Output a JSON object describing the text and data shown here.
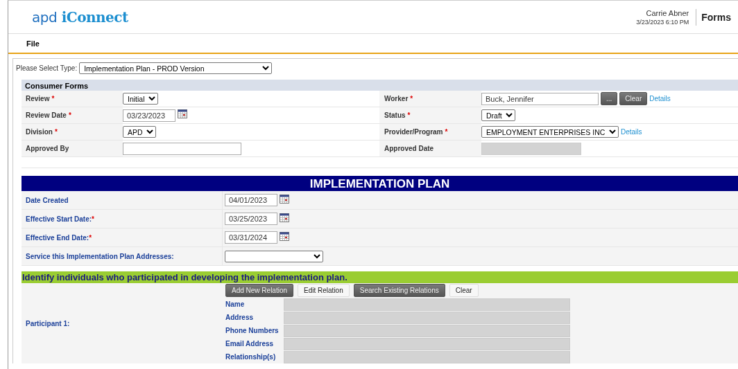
{
  "header": {
    "logo_mark": "apd",
    "logo_text": "iConnect",
    "user": "Carrie Abner",
    "datetime": "3/23/2023 6:10 PM",
    "module": "Forms"
  },
  "menu": [
    {
      "label": "File"
    }
  ],
  "type_select": {
    "label": "Please Select Type:",
    "value": "Implementation Plan - PROD Version"
  },
  "consumer_forms": {
    "title": "Consumer Forms",
    "rows": [
      [
        {
          "label": "Review",
          "required_mark": "*",
          "kind": "select",
          "value": "Initial"
        },
        {
          "label": "Worker",
          "required_mark": "*",
          "kind": "lookup",
          "value": "Buck, Jennifer",
          "buttons": [
            "...",
            "Clear"
          ],
          "link": "Details"
        }
      ],
      [
        {
          "label": "Review Date",
          "required_mark": "*",
          "kind": "date",
          "value": "03/23/2023"
        },
        {
          "label": "Status",
          "required_mark": "*",
          "kind": "select",
          "value": "Draft"
        }
      ],
      [
        {
          "label": "Division",
          "required_mark": "*",
          "kind": "select",
          "value": "APD"
        },
        {
          "label": "Provider/Program",
          "required_mark": "*",
          "kind": "select",
          "value": "EMPLOYMENT ENTERPRISES INC",
          "link": "Details"
        }
      ],
      [
        {
          "label": "Approved By",
          "kind": "text"
        },
        {
          "label": "Approved Date",
          "kind": "readonly"
        }
      ]
    ]
  },
  "plan": {
    "title": "IMPLEMENTATION PLAN",
    "rows": [
      {
        "label": "Date Created",
        "kind": "date",
        "value": "04/01/2023"
      },
      {
        "label": "Effective Start Date:",
        "required_mark": "*",
        "kind": "date",
        "value": "03/25/2023"
      },
      {
        "label": "Effective End Date:",
        "required_mark": "*",
        "kind": "date",
        "value": "03/31/2024"
      },
      {
        "label": "Service this Implementation Plan Addresses:",
        "kind": "select"
      }
    ]
  },
  "participants": {
    "title": "Identify individuals who participated in developing the implementation plan.",
    "items": [
      {
        "label": "Participant 1:",
        "buttons": [
          {
            "label": "Add New Relation",
            "kind": "dark"
          },
          {
            "label": "Edit Relation",
            "kind": "light"
          },
          {
            "label": "Search Existing Relations",
            "kind": "dark"
          },
          {
            "label": "Clear",
            "kind": "light"
          }
        ],
        "fields": [
          "Name",
          "Address",
          "Phone Numbers",
          "Email Address",
          "Relationship(s)"
        ]
      }
    ]
  }
}
